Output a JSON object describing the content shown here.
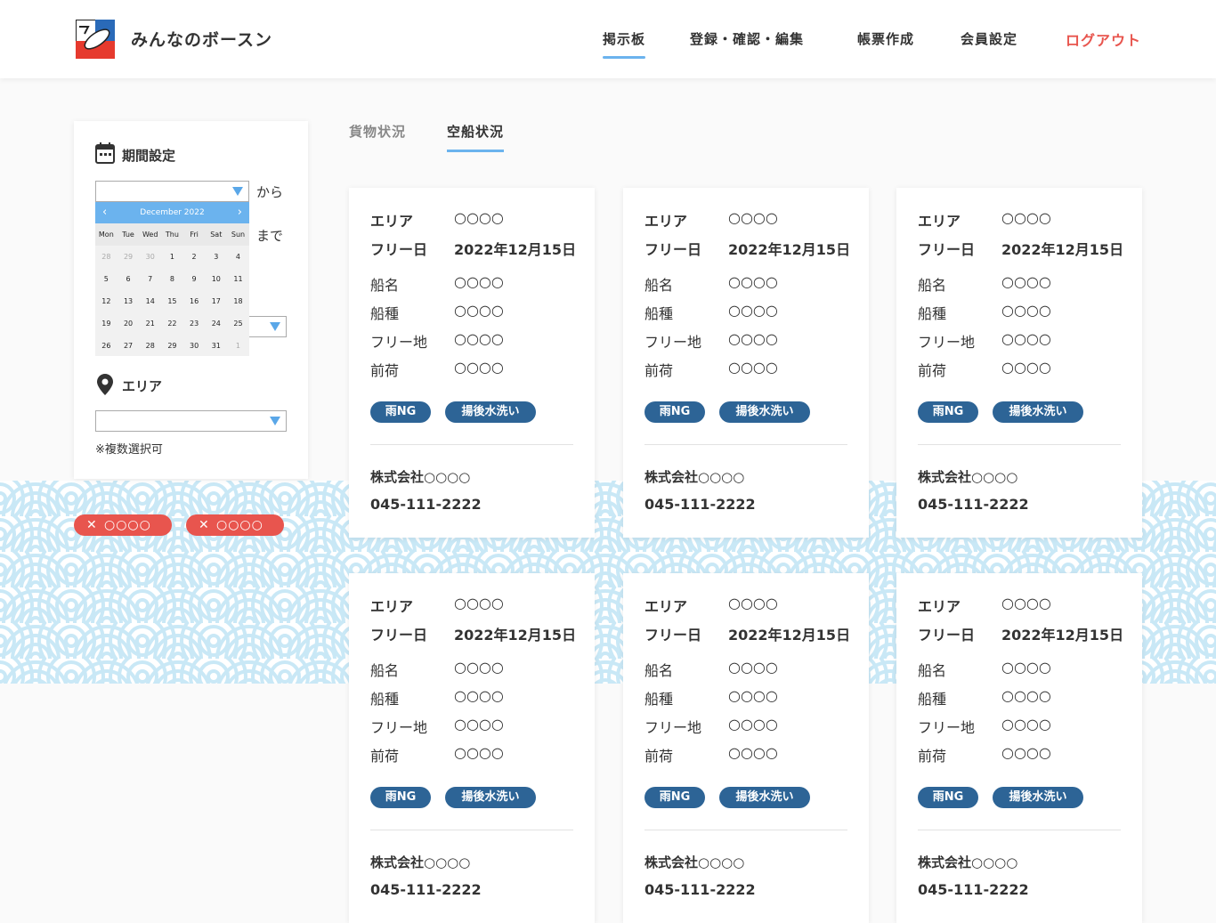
{
  "app": {
    "brand": "みんなのボースン"
  },
  "nav": {
    "items": [
      "掲示板",
      "登録・確認・編集",
      "帳票作成",
      "会員設定"
    ],
    "logout": "ログアウト"
  },
  "sidebar": {
    "period_title": "期間設定",
    "from_label": "から",
    "to_label": "まで",
    "area_title": "エリア",
    "note": "※複数選択可",
    "calendar": {
      "month": "December 2022",
      "dow": [
        "Mon",
        "Tue",
        "Wed",
        "Thu",
        "Fri",
        "Sat",
        "Sun"
      ],
      "weeks": [
        [
          "28",
          "29",
          "30",
          "1",
          "2",
          "3",
          "4"
        ],
        [
          "5",
          "6",
          "7",
          "8",
          "9",
          "10",
          "11"
        ],
        [
          "12",
          "13",
          "14",
          "15",
          "16",
          "17",
          "18"
        ],
        [
          "19",
          "20",
          "21",
          "22",
          "23",
          "24",
          "25"
        ],
        [
          "26",
          "27",
          "28",
          "29",
          "30",
          "31",
          "1"
        ]
      ]
    },
    "chips": [
      "○○○○",
      "○○○○"
    ]
  },
  "tabs": [
    "貨物状況",
    "空船状況"
  ],
  "card": {
    "labels": {
      "area": "エリア",
      "free_date": "フリー日",
      "ship_name": "船名",
      "ship_type": "船種",
      "free_place": "フリー地",
      "previous_cargo": "前荷"
    },
    "values": {
      "area": "○○○○",
      "free_date": "2022年12月15日",
      "ship_name": "○○○○",
      "ship_type": "○○○○",
      "free_place": "○○○○",
      "previous_cargo": "○○○○"
    },
    "tags": [
      "雨NG",
      "揚後水洗い"
    ],
    "company": "株式会社○○○○",
    "phone": "045-111-2222"
  },
  "colors": {
    "accent": "#6bb3ee",
    "logout": "#e8554e",
    "tag": "#2d6496",
    "chip": "#e8554e"
  }
}
